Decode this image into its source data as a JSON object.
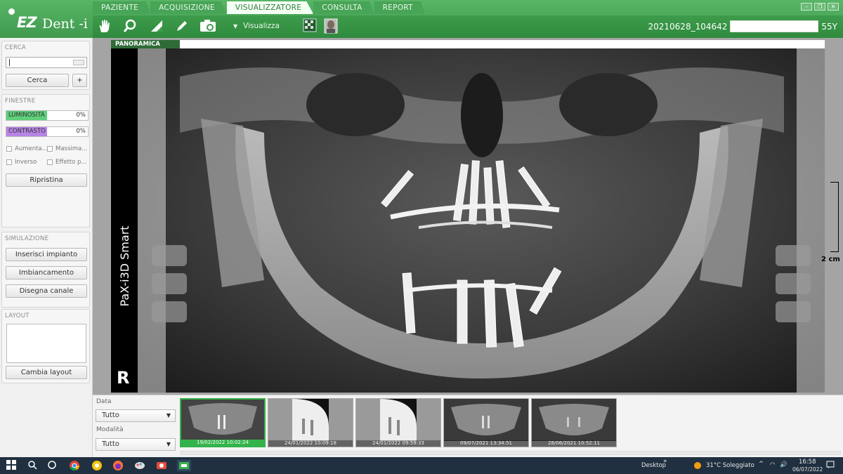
{
  "app": {
    "logo_ez": "EZ",
    "logo_dent": "Dent -i"
  },
  "tabs": [
    {
      "label": "PAZIENTE"
    },
    {
      "label": "ACQUISIZIONE"
    },
    {
      "label": "VISUALIZZATORE",
      "active": true
    },
    {
      "label": "CONSULTA"
    },
    {
      "label": "REPORT"
    }
  ],
  "toolbar": {
    "visualizza_label": "Visualizza",
    "icons": [
      "hand-icon",
      "magnifier-icon",
      "ruler-angle-icon",
      "pencil-icon",
      "camera-capture-icon",
      "checker-icon",
      "patient-face-icon"
    ]
  },
  "patient": {
    "id": "20210628_104642",
    "age": "55Y"
  },
  "left_panel": {
    "search": {
      "title": "CERCA",
      "input_value": "",
      "search_button": "Cerca",
      "plus_button": "+"
    },
    "windows": {
      "title": "FINESTRE",
      "brightness": {
        "label": "LUMINOSITÀ",
        "value": "0%",
        "color": "#5fcf7a"
      },
      "contrast": {
        "label": "CONTRASTO",
        "value": "0%",
        "color": "#b784e6"
      },
      "checkboxes": [
        "Aumenta...",
        "Massima...",
        "Inverso",
        "Effetto p..."
      ],
      "reset_button": "Ripristina"
    },
    "simulation": {
      "title": "SIMULAZIONE",
      "buttons": [
        "Inserisci impianto",
        "Imbiancamento",
        "Disegna canale"
      ]
    },
    "layout": {
      "title": "LAYOUT",
      "change_button": "Cambia layout"
    }
  },
  "viewer": {
    "tag": "PANORAMICA",
    "device_label": "PaX-i3D Smart",
    "side_marker": "R",
    "scale_label": "2 cm"
  },
  "filmstrip": {
    "date_label": "Data",
    "date_value": "Tutto",
    "modality_label": "Modalità",
    "modality_value": "Tutto",
    "thumbnails": [
      {
        "caption": "19/02/2022 10:02:24",
        "selected": true
      },
      {
        "caption": "24/01/2022 10:09:18",
        "selected": false
      },
      {
        "caption": "24/01/2022 09:59:33",
        "selected": false
      },
      {
        "caption": "09/07/2021 13:34:51",
        "selected": false
      },
      {
        "caption": "28/06/2021 10:52:11",
        "selected": false
      }
    ]
  },
  "taskbar": {
    "desktop_label": "Desktop",
    "weather": "31°C  Soleggiato",
    "time": "16:58",
    "date": "06/07/2022"
  }
}
